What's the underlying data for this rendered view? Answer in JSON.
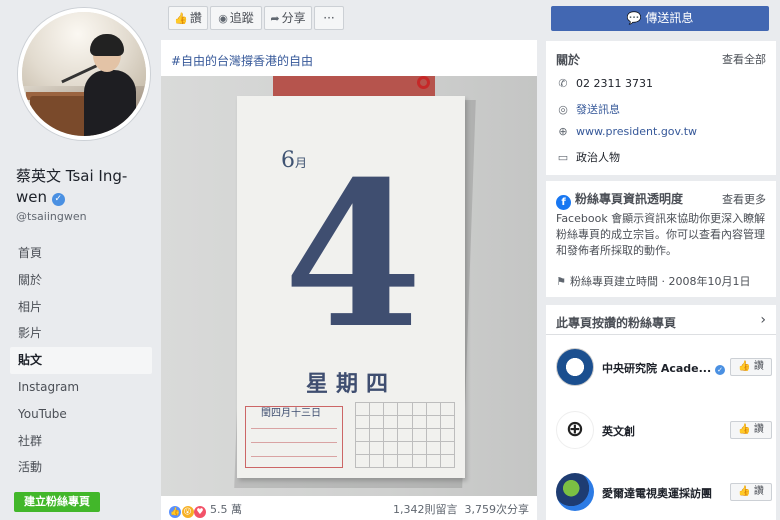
{
  "profile": {
    "name": "蔡英文 Tsai Ing-wen",
    "handle": "@tsaiingwen"
  },
  "nav": {
    "items": [
      {
        "label": "首頁"
      },
      {
        "label": "關於"
      },
      {
        "label": "相片"
      },
      {
        "label": "影片"
      },
      {
        "label": "貼文",
        "active": true
      },
      {
        "label": "Instagram"
      },
      {
        "label": "YouTube"
      },
      {
        "label": "社群"
      },
      {
        "label": "活動"
      }
    ],
    "create_page": "建立粉絲專頁"
  },
  "actions": {
    "like": "讚",
    "follow": "追蹤",
    "share": "分享",
    "more": "···",
    "send_message": "傳送訊息"
  },
  "post": {
    "text": "#自由的台灣撐香港的自由",
    "calendar": {
      "month": "6",
      "month_char": "月",
      "day": "4",
      "weekday": "星期四",
      "lunar": "閏四月十三日"
    },
    "reactions_count": "5.5 萬",
    "comments": "1,342則留言",
    "shares": "3,759次分享"
  },
  "about": {
    "title": "關於",
    "see_all": "查看全部",
    "phone": "02 2311 3731",
    "message": "發送訊息",
    "website": "www.president.gov.tw",
    "category": "政治人物"
  },
  "transparency": {
    "title": "粉絲專頁資訊透明度",
    "see_more": "查看更多",
    "body": "Facebook 會顯示資訊來協助你更深入瞭解粉絲專頁的成立宗旨。你可以查看內容管理和發佈者所採取的動作。",
    "created": "粉絲專頁建立時間 · 2008年10月1日"
  },
  "liked_pages": {
    "title": "此專頁按讚的粉絲專頁",
    "like_label": "讚",
    "items": [
      {
        "name": "中央研究院 Acade..."
      },
      {
        "name": "英文創"
      },
      {
        "name": "愛爾達電視奧運採訪團"
      }
    ]
  },
  "colors": {
    "facebook_blue": "#4267b2",
    "link_blue": "#365899",
    "create_green": "#42b72a",
    "background": "#e9ebee"
  }
}
